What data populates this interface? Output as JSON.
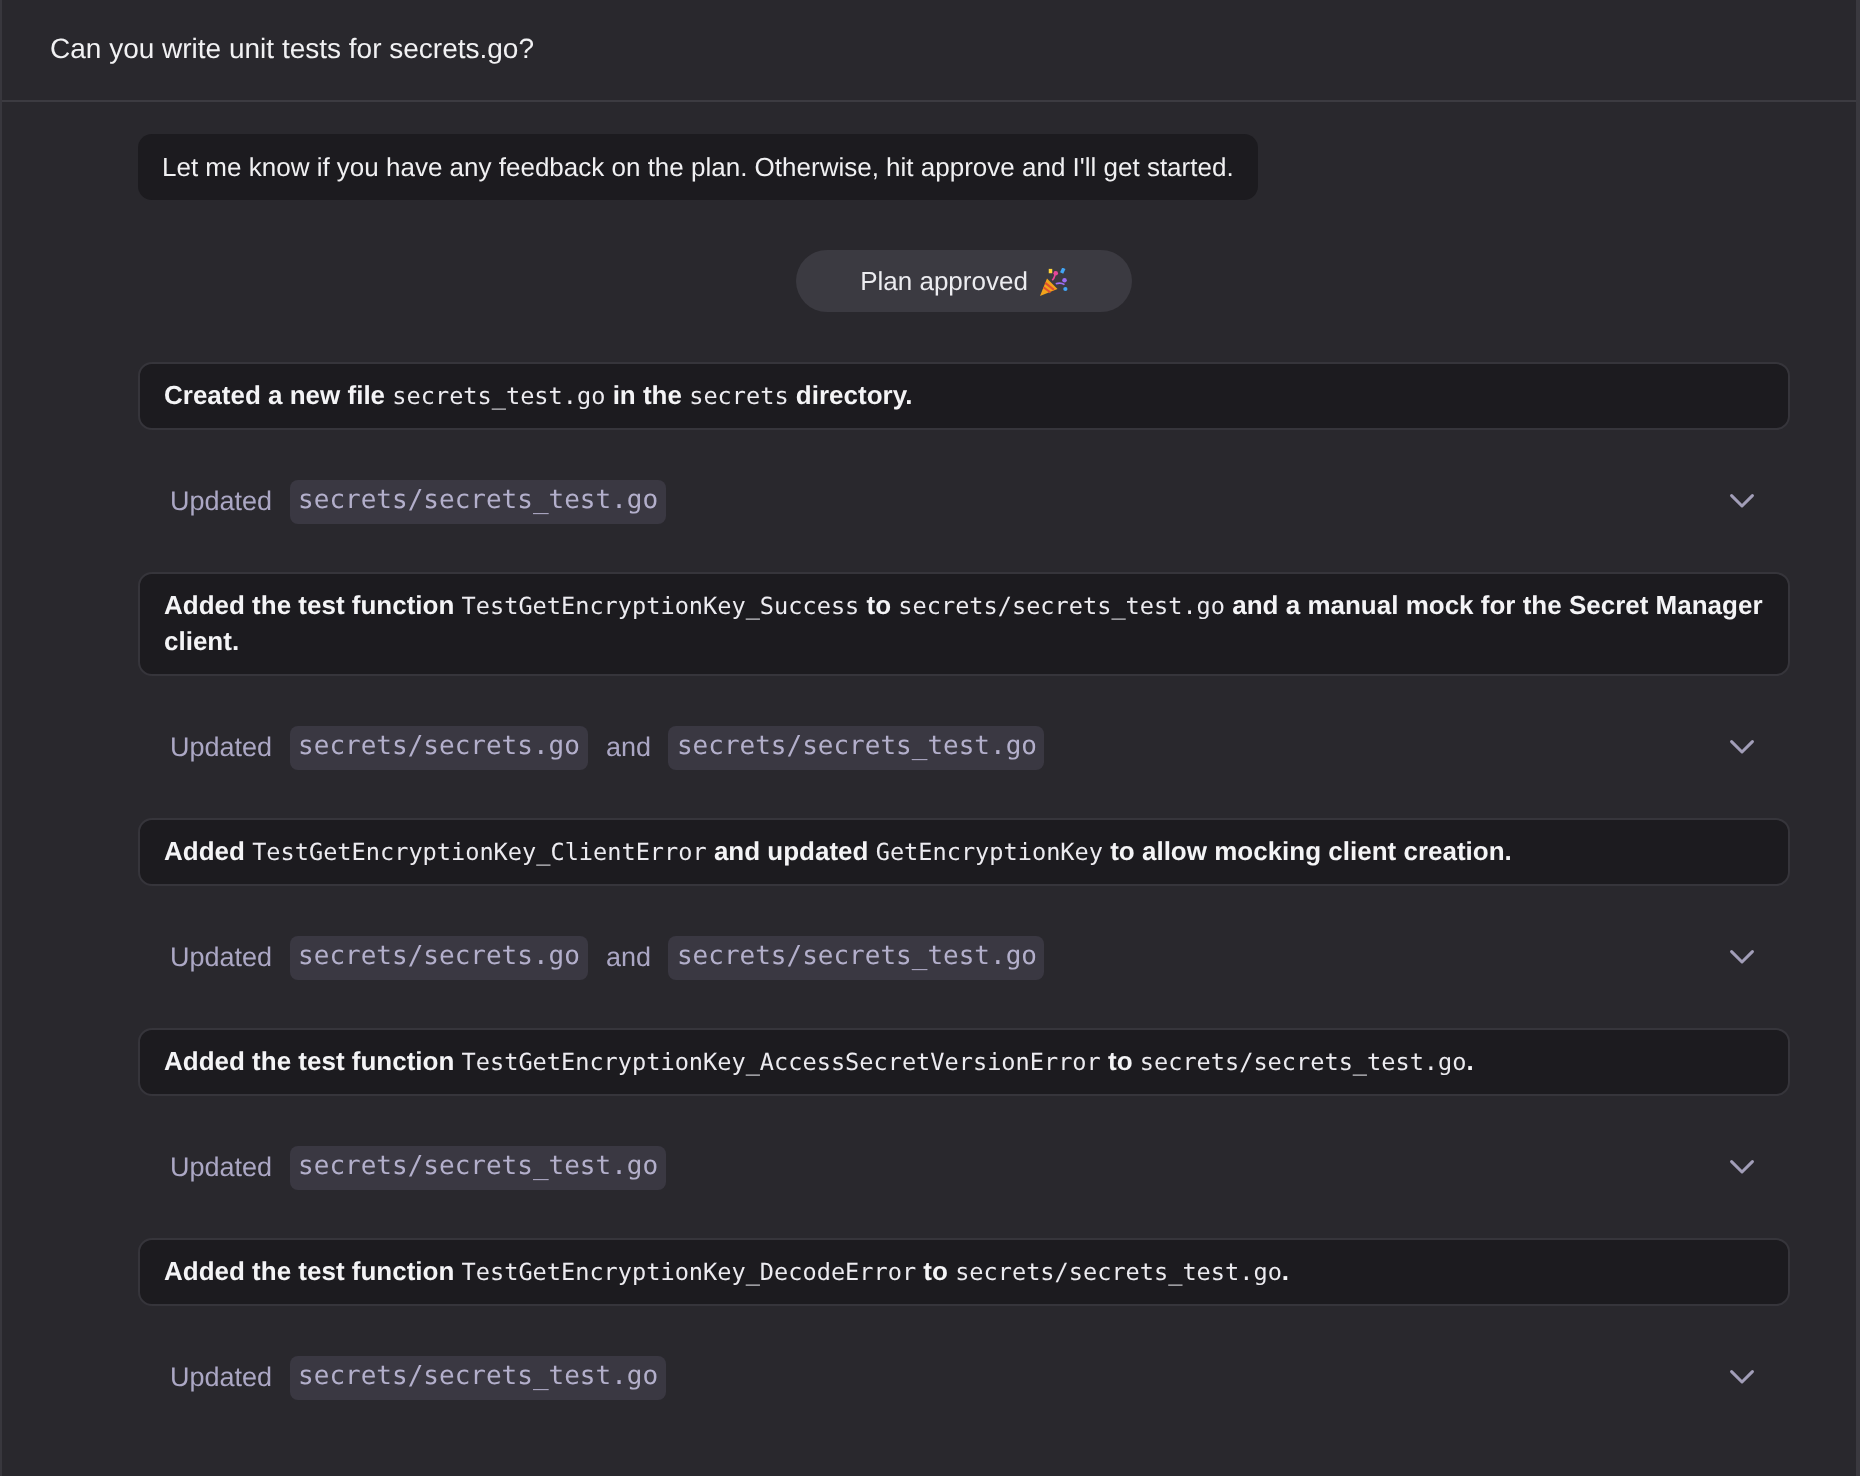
{
  "prompt": {
    "text": "Can you write unit tests for secrets.go?"
  },
  "message": {
    "text": "Let me know if you have any feedback on the plan. Otherwise, hit approve and I'll get started."
  },
  "status_pill": {
    "text": "Plan approved"
  },
  "steps": [
    {
      "summary": [
        {
          "kind": "text",
          "text": "Created a new file "
        },
        {
          "kind": "code",
          "text": "secrets_test.go"
        },
        {
          "kind": "text",
          "text": " in the "
        },
        {
          "kind": "code",
          "text": "secrets"
        },
        {
          "kind": "text",
          "text": " directory."
        }
      ],
      "update": {
        "expanded": false,
        "parts": [
          {
            "kind": "label",
            "text": "Updated"
          },
          {
            "kind": "file",
            "text": "secrets/secrets_test.go"
          }
        ]
      }
    },
    {
      "summary": [
        {
          "kind": "text",
          "text": "Added the test function "
        },
        {
          "kind": "code",
          "text": "TestGetEncryptionKey_Success"
        },
        {
          "kind": "text",
          "text": " to "
        },
        {
          "kind": "code",
          "text": "secrets/secrets_test.go"
        },
        {
          "kind": "text",
          "text": " and a manual mock for the Secret Manager client."
        }
      ],
      "update": {
        "expanded": false,
        "parts": [
          {
            "kind": "label",
            "text": "Updated"
          },
          {
            "kind": "file",
            "text": "secrets/secrets.go"
          },
          {
            "kind": "joiner",
            "text": "and"
          },
          {
            "kind": "file",
            "text": "secrets/secrets_test.go"
          }
        ]
      }
    },
    {
      "summary": [
        {
          "kind": "text",
          "text": "Added "
        },
        {
          "kind": "code",
          "text": "TestGetEncryptionKey_ClientError"
        },
        {
          "kind": "text",
          "text": " and updated "
        },
        {
          "kind": "code",
          "text": "GetEncryptionKey"
        },
        {
          "kind": "text",
          "text": " to allow mocking client creation."
        }
      ],
      "update": {
        "expanded": false,
        "parts": [
          {
            "kind": "label",
            "text": "Updated"
          },
          {
            "kind": "file",
            "text": "secrets/secrets.go"
          },
          {
            "kind": "joiner",
            "text": "and"
          },
          {
            "kind": "file",
            "text": "secrets/secrets_test.go"
          }
        ]
      }
    },
    {
      "summary": [
        {
          "kind": "text",
          "text": "Added the test function "
        },
        {
          "kind": "code",
          "text": "TestGetEncryptionKey_AccessSecretVersionError"
        },
        {
          "kind": "text",
          "text": " to "
        },
        {
          "kind": "code",
          "text": "secrets/secrets_test.go"
        },
        {
          "kind": "text",
          "text": "."
        }
      ],
      "update": {
        "expanded": false,
        "parts": [
          {
            "kind": "label",
            "text": "Updated"
          },
          {
            "kind": "file",
            "text": "secrets/secrets_test.go"
          }
        ]
      }
    },
    {
      "summary": [
        {
          "kind": "text",
          "text": "Added the test function "
        },
        {
          "kind": "code",
          "text": "TestGetEncryptionKey_DecodeError"
        },
        {
          "kind": "text",
          "text": " to "
        },
        {
          "kind": "code",
          "text": "secrets/secrets_test.go"
        },
        {
          "kind": "text",
          "text": "."
        }
      ],
      "update": {
        "expanded": false,
        "parts": [
          {
            "kind": "label",
            "text": "Updated"
          },
          {
            "kind": "file",
            "text": "secrets/secrets_test.go"
          }
        ]
      }
    }
  ]
}
